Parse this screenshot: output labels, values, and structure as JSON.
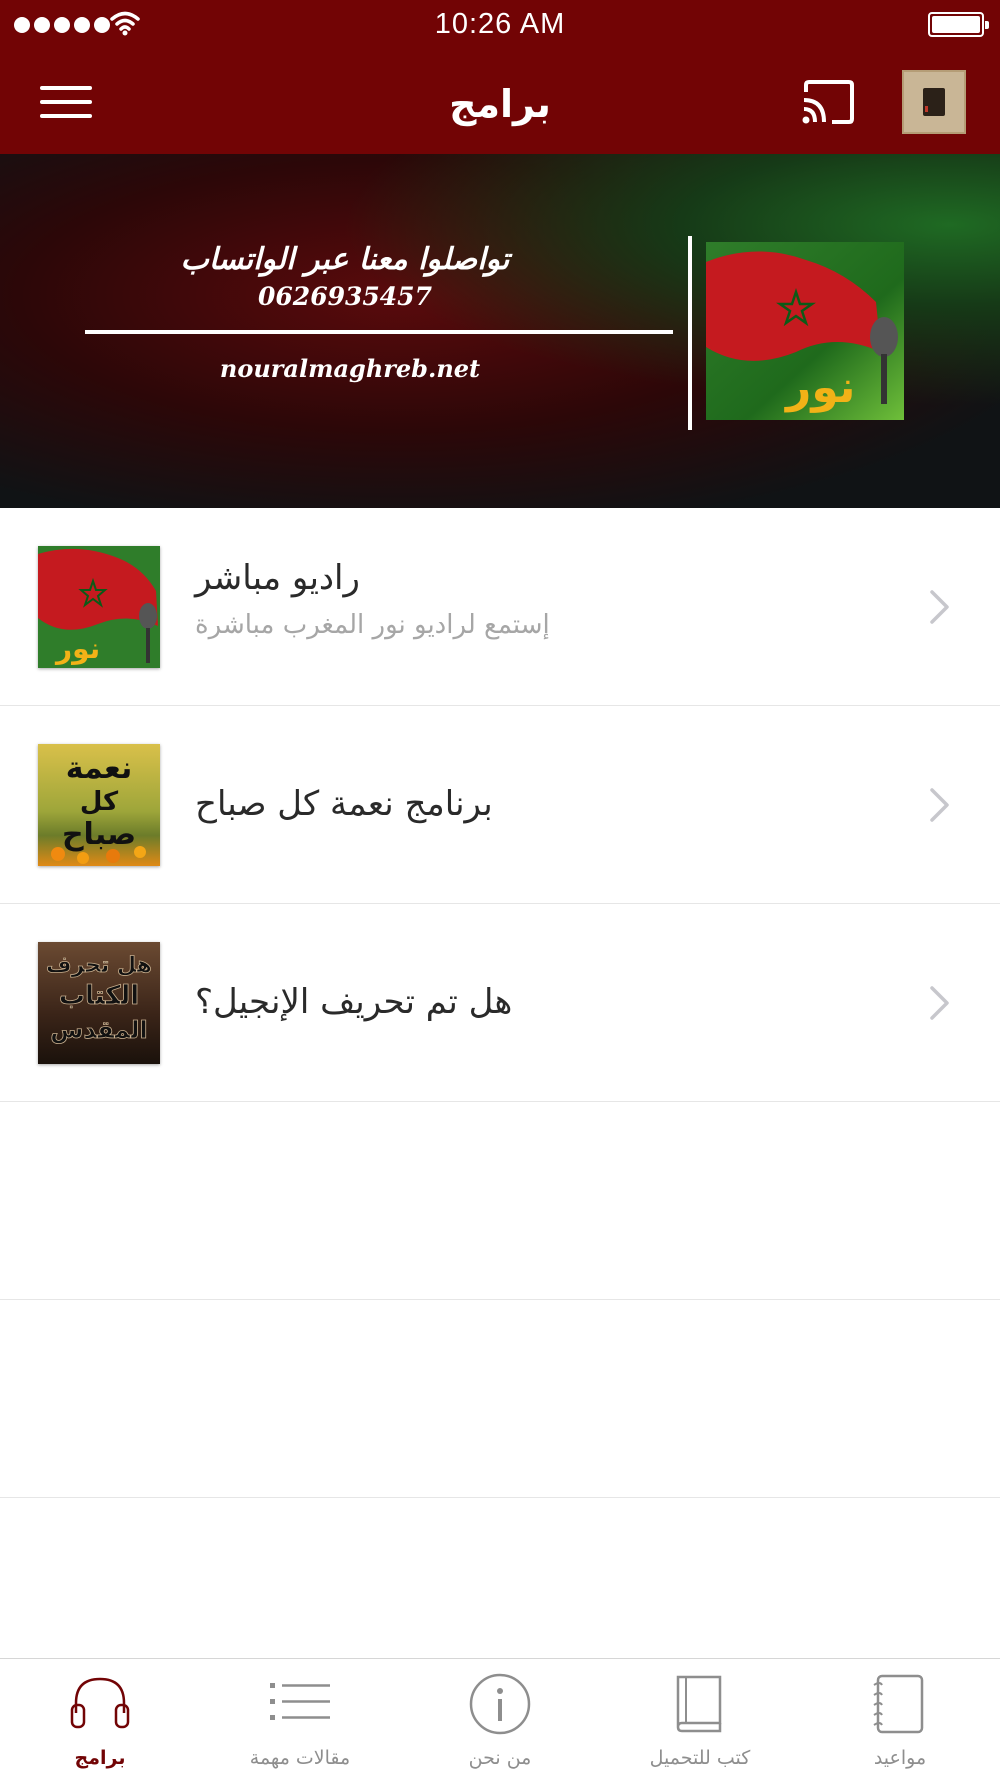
{
  "status_bar": {
    "time": "10:26 AM"
  },
  "nav": {
    "title": "برامج"
  },
  "banner": {
    "headline": "تواصلوا معنا عبر الواتساب",
    "phone": "0626935457",
    "url": "nouralmaghreb.net"
  },
  "list": {
    "items": [
      {
        "title": "راديو مباشر",
        "subtitle": "إستمع لراديو نور المغرب مباشرة"
      },
      {
        "title": "برنامج نعمة كل صباح"
      },
      {
        "title": "هل تم تحريف الإنجيل؟"
      }
    ]
  },
  "thumbs": {
    "morning": [
      "نعمة",
      "كل",
      "صباح"
    ],
    "bible": [
      "هل تحرف",
      "الكتاب",
      "المقدس"
    ]
  },
  "tabs": [
    {
      "label": "برامج",
      "icon": "headphones-icon",
      "active": true
    },
    {
      "label": "مقالات مهمة",
      "icon": "list-icon",
      "active": false
    },
    {
      "label": "من نحن",
      "icon": "info-icon",
      "active": false
    },
    {
      "label": "كتب للتحميل",
      "icon": "book-icon",
      "active": false
    },
    {
      "label": "مواعيد",
      "icon": "notebook-icon",
      "active": false
    }
  ],
  "colors": {
    "brand": "#720405",
    "muted_text": "#a6a6a6",
    "chevron": "#c7c7cc"
  }
}
